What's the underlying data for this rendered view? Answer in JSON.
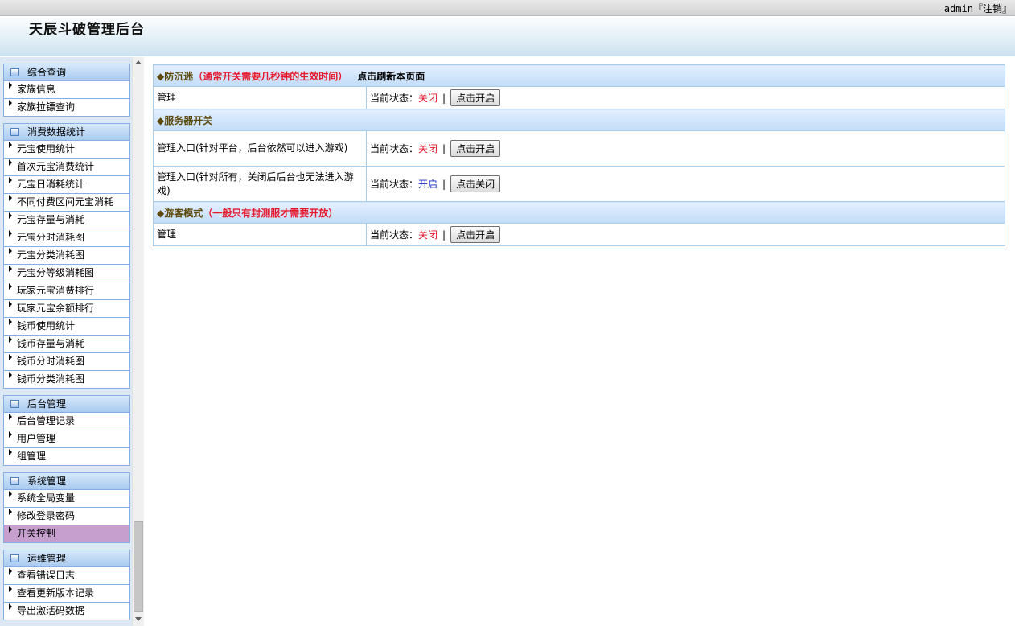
{
  "topbar": {
    "username": "admin",
    "logout_label": "『注销』"
  },
  "header": {
    "title": "天辰斗破管理后台"
  },
  "sidebar": {
    "groups": [
      {
        "title": "综合查询",
        "items": [
          "家族信息",
          "家族拉镖查询"
        ]
      },
      {
        "title": "消费数据统计",
        "items": [
          "元宝使用统计",
          "首次元宝消费统计",
          "元宝日消耗统计",
          "不同付费区间元宝消耗",
          "元宝存量与消耗",
          "元宝分时消耗图",
          "元宝分类消耗图",
          "元宝分等级消耗图",
          "玩家元宝消费排行",
          "玩家元宝余额排行",
          "钱币使用统计",
          "钱币存量与消耗",
          "钱币分时消耗图",
          "钱币分类消耗图"
        ]
      },
      {
        "title": "后台管理",
        "items": [
          "后台管理记录",
          "用户管理",
          "组管理"
        ]
      },
      {
        "title": "系统管理",
        "items": [
          "系统全局变量",
          "修改登录密码",
          "开关控制"
        ]
      },
      {
        "title": "运维管理",
        "items": [
          "查看错误日志",
          "查看更新版本记录",
          "导出激活码数据"
        ]
      }
    ],
    "active_item": "开关控制"
  },
  "main": {
    "status_label": "当前状态：",
    "separator": "|",
    "sections": [
      {
        "title": "◆防沉迷",
        "note": "（通常开关需要几秒钟的生效时间）",
        "refresh": "点击刷新本页面",
        "rows": [
          {
            "label": "管理",
            "status": "关闭",
            "state": "off",
            "button": "点击开启"
          }
        ]
      },
      {
        "title": "◆服务器开关",
        "note": "",
        "refresh": "",
        "rows": [
          {
            "label": "管理入口(针对平台，后台依然可以进入游戏)",
            "status": "关闭",
            "state": "off",
            "button": "点击开启"
          },
          {
            "label": "管理入口(针对所有，关闭后后台也无法进入游戏)",
            "status": "开启",
            "state": "on",
            "button": "点击关闭"
          }
        ]
      },
      {
        "title": "◆游客模式",
        "note": "（一般只有封测服才需要开放）",
        "refresh": "",
        "rows": [
          {
            "label": "管理",
            "status": "关闭",
            "state": "off",
            "button": "点击开启"
          }
        ]
      }
    ]
  },
  "colors": {
    "status_off": "#e8182c",
    "status_on": "#1a2bc8",
    "active_item": "#c69fcf",
    "section_title": "#5c4a0d"
  }
}
